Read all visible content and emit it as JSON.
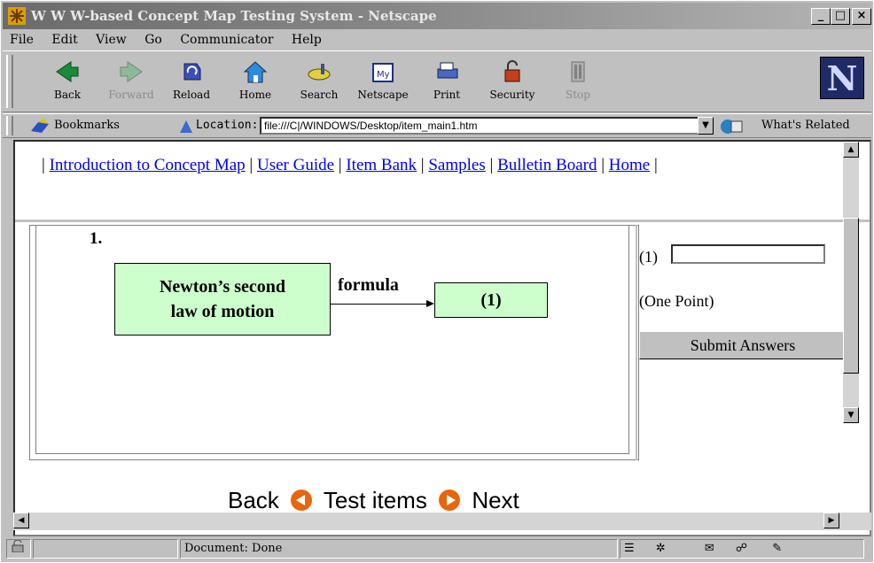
{
  "window": {
    "title": "W W W-based Concept Map Testing System - Netscape",
    "min": "_",
    "max": "□",
    "close": "×"
  },
  "menu": [
    "File",
    "Edit",
    "View",
    "Go",
    "Communicator",
    "Help"
  ],
  "toolbar": {
    "back": "Back",
    "forward": "Forward",
    "reload": "Reload",
    "home": "Home",
    "search": "Search",
    "netscape": "Netscape",
    "print": "Print",
    "security": "Security",
    "stop": "Stop",
    "logo": "N"
  },
  "location": {
    "bookmarks": "Bookmarks",
    "label": "Location:",
    "url": "file:///C|/WINDOWS/Desktop/item_main1.htm",
    "related": "What's Related"
  },
  "nav": {
    "intro": "Introduction to Concept Map",
    "guide": "User Guide",
    "bank": "Item Bank",
    "samples": "Samples",
    "bulletin": "Bulletin Board",
    "home": "Home"
  },
  "item": {
    "number": "1.",
    "concept1_line1": "Newton’s second",
    "concept1_line2": "law of motion",
    "link": "formula",
    "blank": "(1)"
  },
  "answer": {
    "label": "(1)",
    "value": "",
    "points": "(One Point)",
    "submit": "Submit Answers"
  },
  "bottom": {
    "back": "Back",
    "middle": "Test items",
    "next": "Next"
  },
  "status": {
    "text": "Document: Done"
  }
}
